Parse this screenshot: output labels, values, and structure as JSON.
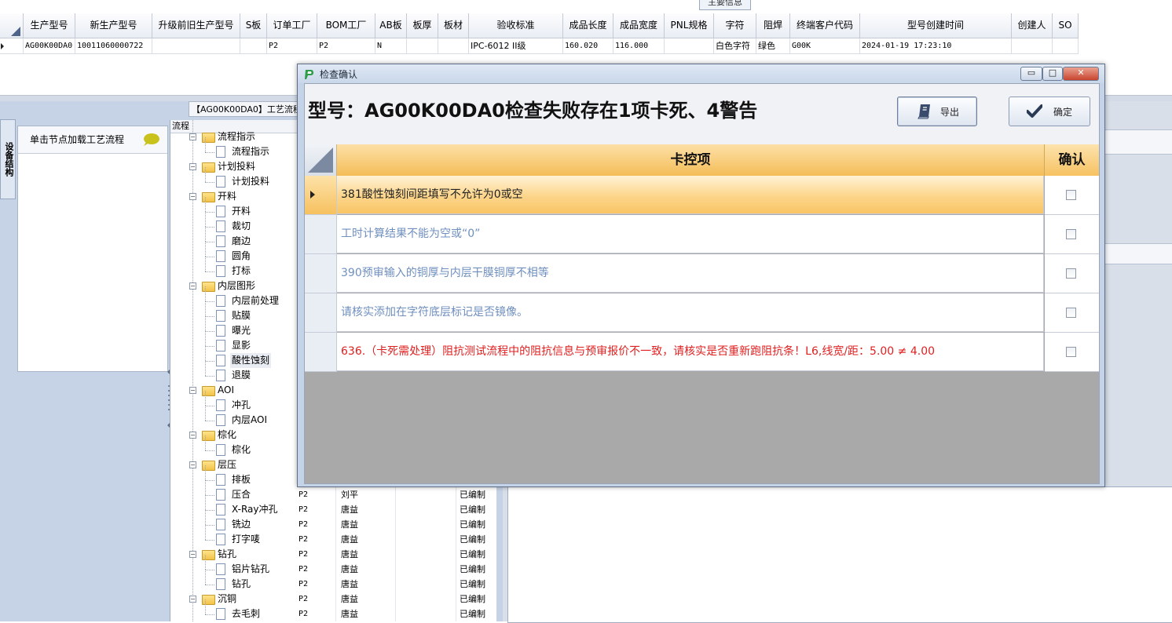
{
  "top": {
    "tab_label": "主要信息",
    "columns": [
      "生产型号",
      "新生产型号",
      "升级前旧生产型号",
      "S板",
      "订单工厂",
      "BOM工厂",
      "AB板",
      "板厚",
      "板材",
      "验收标准",
      "成品长度",
      "成品宽度",
      "PNL规格",
      "字符",
      "阻焊",
      "终端客户代码",
      "型号创建时间",
      "创建人",
      "SO"
    ],
    "row": [
      "AG00K00DA0",
      "10011060000722",
      "",
      "",
      "P2",
      "P2",
      "N",
      "",
      "",
      "IPC-6012 II级",
      "160.020",
      "116.000",
      "",
      "白色字符",
      "绿色",
      "G00K",
      "2024-01-19 17:23:10",
      "",
      ""
    ]
  },
  "left": {
    "vertical_tab": "设备结构",
    "process_tab": "【AG00K00DA0】工艺流程",
    "load_hint": "单击节点加载工艺流程",
    "tree_header": "流程"
  },
  "tree": [
    {
      "label": "流程指示",
      "level": 0,
      "partial": true
    },
    {
      "label": "流程指示",
      "level": 1
    },
    {
      "label": "计划投料",
      "level": 0
    },
    {
      "label": "计划投料",
      "level": 1
    },
    {
      "label": "开料",
      "level": 0
    },
    {
      "label": "开料",
      "level": 1
    },
    {
      "label": "裁切",
      "level": 1
    },
    {
      "label": "磨边",
      "level": 1
    },
    {
      "label": "圆角",
      "level": 1
    },
    {
      "label": "打标",
      "level": 1
    },
    {
      "label": "内层图形",
      "level": 0
    },
    {
      "label": "内层前处理",
      "level": 1
    },
    {
      "label": "贴膜",
      "level": 1
    },
    {
      "label": "曝光",
      "level": 1
    },
    {
      "label": "显影",
      "level": 1
    },
    {
      "label": "酸性蚀刻",
      "level": 1,
      "selected": true
    },
    {
      "label": "退膜",
      "level": 1
    },
    {
      "label": "AOI",
      "level": 0
    },
    {
      "label": "冲孔",
      "level": 1
    },
    {
      "label": "内层AOI",
      "level": 1
    },
    {
      "label": "棕化",
      "level": 0
    },
    {
      "label": "棕化",
      "level": 1
    },
    {
      "label": "层压",
      "level": 0
    },
    {
      "label": "排板",
      "level": 1
    },
    {
      "label": "压合",
      "level": 1
    },
    {
      "label": "X-Ray冲孔",
      "level": 1
    },
    {
      "label": "铣边",
      "level": 1
    },
    {
      "label": "打字唛",
      "level": 1
    },
    {
      "label": "钻孔",
      "level": 0
    },
    {
      "label": "铝片钻孔",
      "level": 1
    },
    {
      "label": "钻孔",
      "level": 1
    },
    {
      "label": "沉铜",
      "level": 0
    },
    {
      "label": "去毛刺",
      "level": 1
    }
  ],
  "process_rows": [
    {
      "plant": "P2",
      "person": "刘平",
      "status": "已编制"
    },
    {
      "plant": "P2",
      "person": "唐益",
      "status": "已编制"
    },
    {
      "plant": "P2",
      "person": "唐益",
      "status": "已编制"
    },
    {
      "plant": "P2",
      "person": "唐益",
      "status": "已编制"
    },
    {
      "plant": "P2",
      "person": "唐益",
      "status": "已编制"
    },
    {
      "plant": "P2",
      "person": "唐益",
      "status": "已编制"
    },
    {
      "plant": "P2",
      "person": "唐益",
      "status": "已编制"
    },
    {
      "plant": "P2",
      "person": "唐益",
      "status": "已编制"
    },
    {
      "plant": "P2",
      "person": "唐益",
      "status": "已编制"
    }
  ],
  "dialog": {
    "title": "检查确认",
    "heading": "型号：AG00K00DA0检查失败存在1项卡死、4警告",
    "export_label": "导出",
    "confirm_label": "确定",
    "col_item": "卡控项",
    "col_confirm": "确认",
    "rows": [
      {
        "text": "381酸性蚀刻间距填写不允许为0或空",
        "color": "#222222",
        "selected": true
      },
      {
        "text": "工时计算结果不能为空或“0”",
        "color": "#6f8fbf"
      },
      {
        "text": "390预审输入的铜厚与内层干膜铜厚不相等",
        "color": "#6f8fbf"
      },
      {
        "text": "请核实添加在字符底层标记是否镜像。",
        "color": "#6f8fbf"
      },
      {
        "text": "636.（卡死需处理）阻抗测试流程中的阻抗信息与预审报价不一致，请核实是否重新跑阻抗条！L6,线宽/距：5.00 ≠ 4.00",
        "color": "#e02020"
      }
    ]
  },
  "colors": {
    "accent": "#f4bd58",
    "blocking": "#e02020",
    "warning": "#6f8fbf"
  }
}
